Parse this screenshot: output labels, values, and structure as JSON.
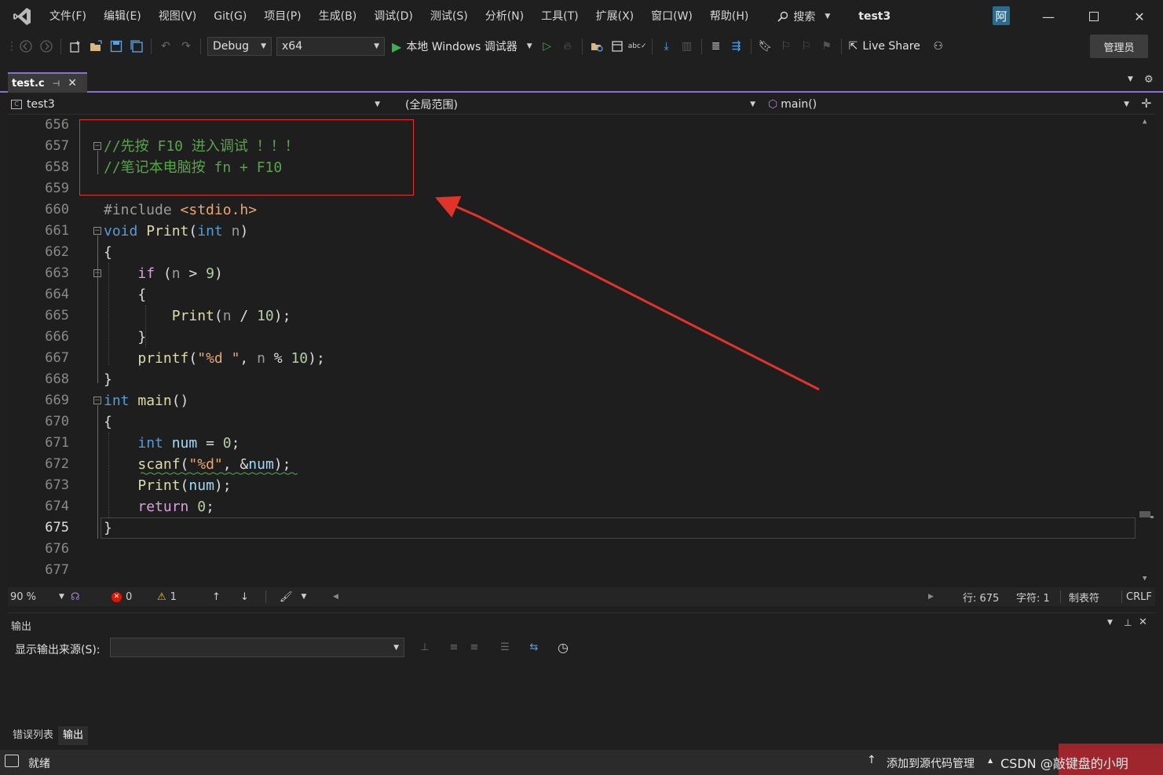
{
  "menu": {
    "items": [
      "文件(F)",
      "编辑(E)",
      "视图(V)",
      "Git(G)",
      "项目(P)",
      "生成(B)",
      "调试(D)",
      "测试(S)",
      "分析(N)",
      "工具(T)",
      "扩展(X)",
      "窗口(W)",
      "帮助(H)"
    ],
    "search_label": "搜索",
    "solution_name": "test3",
    "user_initial": "阿"
  },
  "toolbar": {
    "config": "Debug",
    "platform": "x64",
    "run_label": "本地 Windows 调试器",
    "live_share": "Live Share",
    "admin_label": "管理员"
  },
  "tabs": {
    "active_file": "test.c"
  },
  "navbar": {
    "project": "test3",
    "scope": "(全局范围)",
    "member": "main()"
  },
  "editor": {
    "line_numbers": [
      "656",
      "657",
      "658",
      "659",
      "660",
      "661",
      "662",
      "663",
      "664",
      "665",
      "666",
      "667",
      "668",
      "669",
      "670",
      "671",
      "672",
      "673",
      "674",
      "675",
      "676",
      "677"
    ],
    "current_line": "675",
    "comment_1": "//先按 F10 进入调试 ！！！",
    "comment_2": "//笔记本电脑按 fn + F10"
  },
  "edstatus": {
    "zoom": "90 %",
    "errors": "0",
    "warnings": "1",
    "line": "行: 675",
    "col": "字符: 1",
    "tabs": "制表符",
    "eol": "CRLF"
  },
  "output": {
    "title": "输出",
    "source_label": "显示输出来源(S):"
  },
  "bottom_tabs": [
    "错误列表",
    "输出"
  ],
  "status": {
    "ready": "就绪",
    "add_source_control": "添加到源代码管理",
    "watermark": "CSDN @敲键盘的小明"
  },
  "colors": {
    "accent": "#8c6fd3",
    "annotation_red": "#e0342b",
    "comment_green": "#57a64a",
    "keyword_blue": "#569cd6"
  }
}
